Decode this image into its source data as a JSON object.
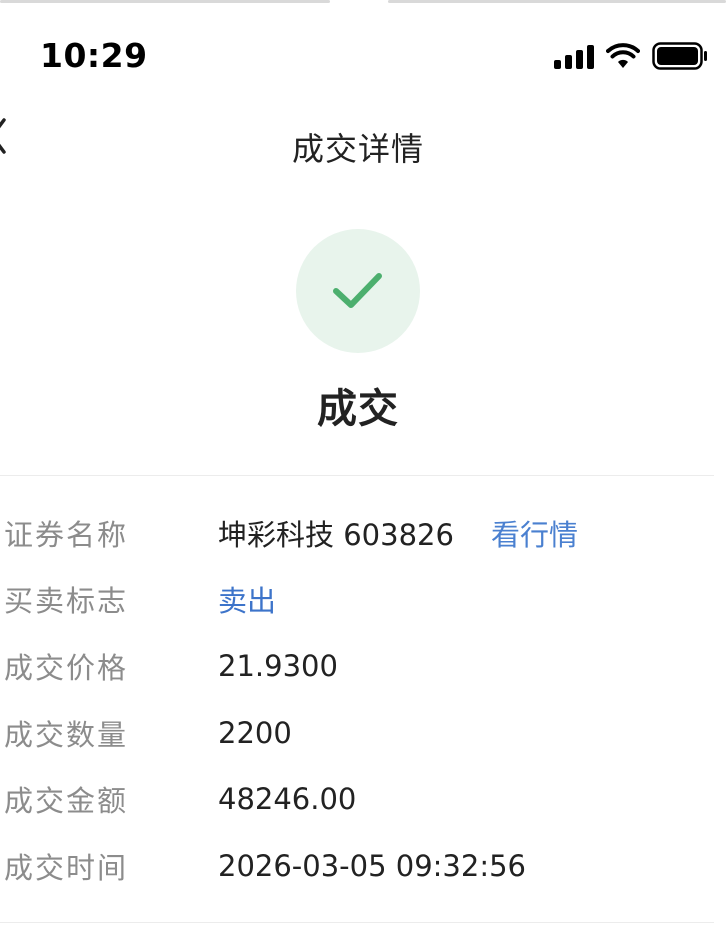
{
  "status_bar": {
    "time": "10:29",
    "icons": [
      "signal-icon",
      "wifi-icon",
      "battery-icon"
    ]
  },
  "nav": {
    "back_icon": "chevron-left-icon",
    "title": "成交详情"
  },
  "result": {
    "icon": "checkmark-icon",
    "title": "成交",
    "accent_color": "#4caf6e",
    "circle_color": "#e8f4ec"
  },
  "details": {
    "security_name": {
      "label": "证券名称",
      "value": "坤彩科技 603826",
      "link": "看行情"
    },
    "direction": {
      "label": "买卖标志",
      "value": "卖出"
    },
    "price": {
      "label": "成交价格",
      "value": "21.9300"
    },
    "quantity": {
      "label": "成交数量",
      "value": "2200"
    },
    "amount": {
      "label": "成交金额",
      "value": "48246.00"
    },
    "time": {
      "label": "成交时间",
      "value": "2026-03-05 09:32:56"
    }
  },
  "colors": {
    "label": "#8c8c8c",
    "value": "#222222",
    "link": "#4a80d0",
    "sell": "#3d74ca"
  }
}
